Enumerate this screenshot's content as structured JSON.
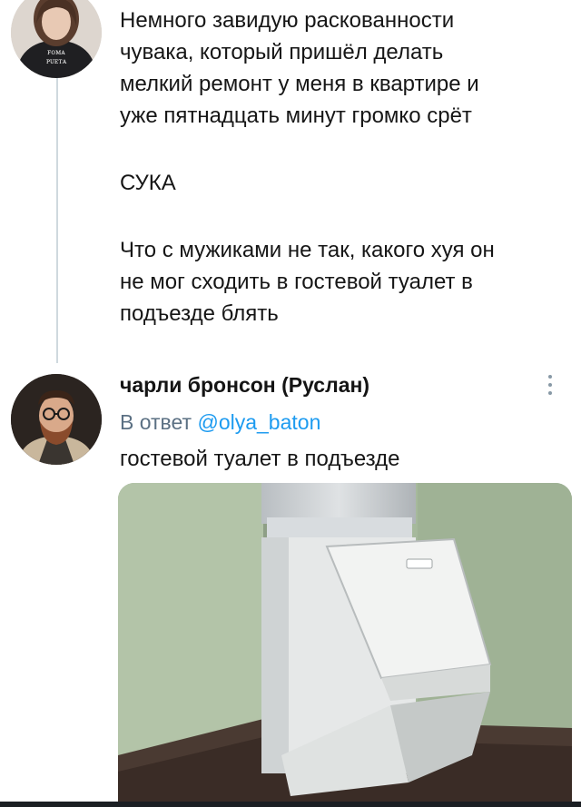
{
  "original_tweet": {
    "lines": [
      "Немного завидую раскованности",
      "чувака, который пришёл делать",
      "мелкий ремонт у меня в квартире и",
      "уже пятнадцать минут громко срёт",
      "СУКА",
      "Что с мужиками не так, какого хуя он",
      "не мог сходить в гостевой туалет в",
      "подъезде блять"
    ]
  },
  "reply_tweet": {
    "author_name": "чарли бронсон (Руслан)",
    "reply_prefix": "В ответ",
    "reply_to": "@olya_baton",
    "text": "гостевой туалет в подъезде"
  },
  "icons": {
    "more": "more-vertical-icon"
  }
}
